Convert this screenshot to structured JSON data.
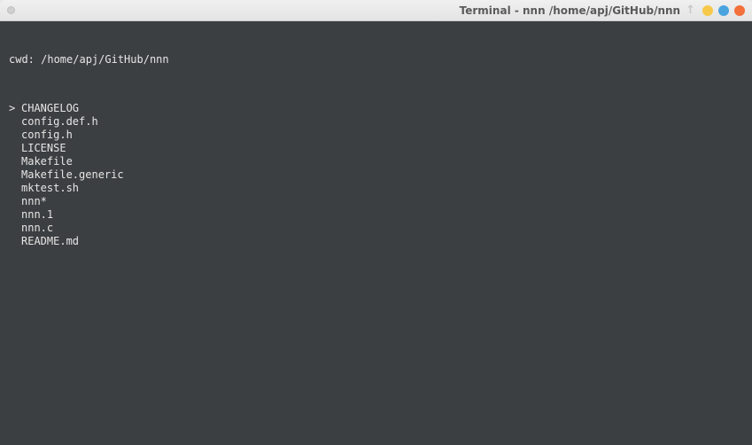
{
  "titlebar": {
    "title": "Terminal - nnn  /home/apj/GitHub/nnn",
    "arrow": "↑"
  },
  "cwd_label": "cwd: ",
  "cwd_path": "/home/apj/GitHub/nnn",
  "cursor_char": ">",
  "files": [
    "CHANGELOG",
    "config.def.h",
    "config.h",
    "LICENSE",
    "Makefile",
    "Makefile.generic",
    "mktest.sh",
    "nnn*",
    "nnn.1",
    "nnn.c",
    "README.md"
  ],
  "selected_index": 0
}
